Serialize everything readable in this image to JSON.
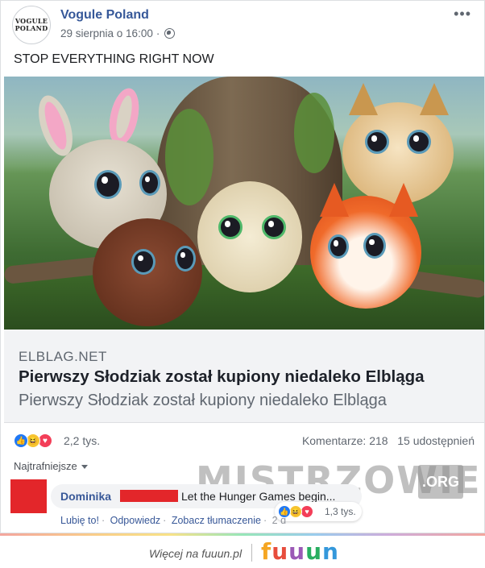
{
  "post": {
    "avatar_text": [
      "VOGULE",
      "POLAND"
    ],
    "page_name": "Vogule Poland",
    "date": "29 sierpnia o 16:00",
    "separator": "·",
    "more_icon": "more-dots-icon",
    "privacy_icon": "globe-icon",
    "text": "STOP EVERYTHING RIGHT NOW"
  },
  "link_preview": {
    "domain": "ELBLAG.NET",
    "title": "Pierwszy Słodziak został kupiony niedaleko Elbląga",
    "description": "Pierwszy Słodziak został kupiony niedaleko Elbląga"
  },
  "reactions": {
    "types": [
      "like",
      "haha",
      "love"
    ],
    "count": "2,2 tys.",
    "comments": "Komentarze: 218",
    "shares": "15 udostępnień"
  },
  "sort_label": "Najtrafniejsze",
  "watermark": {
    "text": "MISTRZOWIE",
    "suffix": ".ORG"
  },
  "comment": {
    "author": "Dominika",
    "text": "Let the Hunger Games begin...",
    "reaction_count": "1,3 tys.",
    "actions": {
      "like": "Lubię to!",
      "reply": "Odpowiedz",
      "translate": "Zobacz tłumaczenie",
      "time": "2 d"
    },
    "redaction_color": "#e3262a"
  },
  "footer": {
    "more_text": "Więcej na fuuun.pl",
    "logo": [
      "f",
      "u",
      "u",
      "u",
      "n"
    ],
    "logo_colors": [
      "#f5a623",
      "#e74c3c",
      "#9b59b6",
      "#27ae60",
      "#3498db"
    ]
  },
  "colors": {
    "link_blue": "#365899",
    "like_blue": "#2078f4",
    "haha_yellow": "#f7c532",
    "love_red": "#f33e58"
  }
}
